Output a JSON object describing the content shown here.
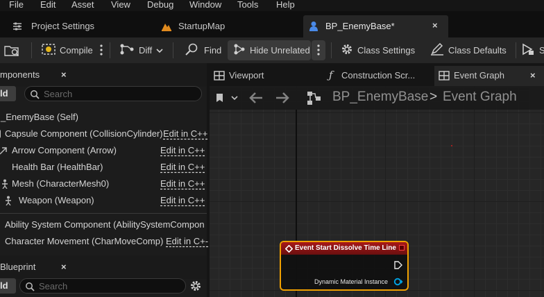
{
  "menu": [
    "File",
    "Edit",
    "Asset",
    "View",
    "Debug",
    "Window",
    "Tools",
    "Help"
  ],
  "tabs": [
    {
      "label": "Project Settings",
      "icon": "settings-sliders-icon"
    },
    {
      "label": "StartupMap",
      "icon": "level-map-icon"
    },
    {
      "label": "BP_EnemyBase*",
      "icon": "pawn-blueprint-icon",
      "close": "×"
    }
  ],
  "toolbar": {
    "compile": "Compile",
    "diff": "Diff",
    "find": "Find",
    "hide_unrelated": "Hide Unrelated",
    "class_settings": "Class Settings",
    "class_defaults": "Class Defaults",
    "simulate": "S"
  },
  "components_panel": {
    "title": "mponents",
    "close": "×",
    "add": "ld",
    "search_placeholder": "Search",
    "root": "_EnemyBase (Self)",
    "items": [
      {
        "label": "Capsule Component (CollisionCylinder)",
        "link": "Edit in C++"
      },
      {
        "label": "Arrow Component (Arrow)",
        "link": "Edit in C++"
      },
      {
        "label": "Health Bar (HealthBar)",
        "link": "Edit in C++"
      },
      {
        "label": "Mesh (CharacterMesh0)",
        "link": "Edit in C++"
      },
      {
        "label": "Weapon (Weapon)",
        "link": "Edit in C++"
      }
    ],
    "extra_items": [
      {
        "label": "Ability System Component (AbilitySystemCompone"
      },
      {
        "label": "Character Movement (CharMoveComp)",
        "link": "Edit in C+-"
      }
    ]
  },
  "blueprint_panel": {
    "title": "Blueprint",
    "close": "×",
    "add": "ld",
    "search_placeholder": "Search"
  },
  "graph_tabs": [
    {
      "label": "Viewport"
    },
    {
      "label": "Construction Scr..."
    },
    {
      "label": "Event Graph",
      "close": "×"
    }
  ],
  "breadcrumb": {
    "blueprint": "BP_EnemyBase",
    "separator": ">",
    "graph": "Event Graph"
  },
  "node": {
    "title": "Event Start Dissolve Time Line",
    "output_pin": "Dynamic Material Instance"
  },
  "colors": {
    "node_header": "#a81818",
    "node_selected_border": "#f0a000",
    "pin_object": "#00a0e0"
  }
}
